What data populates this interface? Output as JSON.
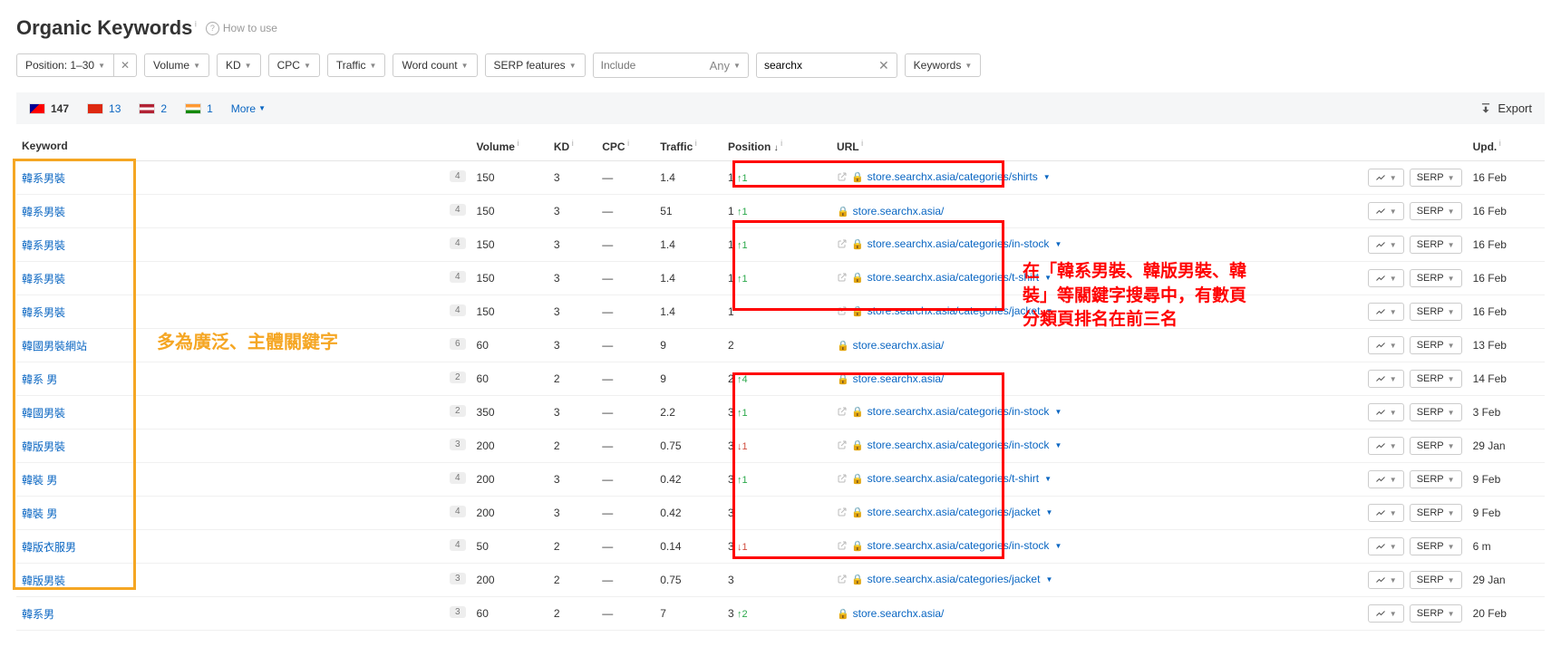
{
  "header": {
    "title": "Organic Keywords",
    "how_to_use": "How to use"
  },
  "filters": {
    "position": {
      "label": "Position: 1–30"
    },
    "volume": "Volume",
    "kd": "KD",
    "cpc": "CPC",
    "traffic": "Traffic",
    "wordcount": "Word count",
    "serp": "SERP features",
    "include": {
      "placeholder": "Include",
      "mode": "Any"
    },
    "search": {
      "value": "searchx"
    },
    "keywords": "Keywords"
  },
  "countries": [
    {
      "name": "TW",
      "count": "147",
      "flag_bg": "linear-gradient(135deg,#fe0000 50%,#000095 50%)"
    },
    {
      "name": "HK",
      "count": "13",
      "flag_bg": "#de2910"
    },
    {
      "name": "US",
      "count": "2",
      "flag_bg": "linear-gradient(#b22234 33%,#fff 33%,#fff 66%,#b22234 66%)"
    },
    {
      "name": "IN",
      "count": "1",
      "flag_bg": "linear-gradient(#ff9933 33%,#fff 33%,#fff 66%,#138808 66%)"
    }
  ],
  "more_label": "More",
  "export_label": "Export",
  "columns": {
    "keyword": "Keyword",
    "volume": "Volume",
    "kd": "KD",
    "cpc": "CPC",
    "traffic": "Traffic",
    "position": "Position",
    "url": "URL",
    "upd": "Upd."
  },
  "serp_btn": "SERP",
  "rows": [
    {
      "kw": "韓系男裝",
      "badge": "4",
      "vol": "150",
      "kd": "3",
      "cpc": "—",
      "traffic": "1.4",
      "pos": "1",
      "pos_ch": "1",
      "pos_dir": "up",
      "url": "store.searchx.asia/categories/shirts",
      "has_ext": true,
      "has_url_caret": true,
      "upd": "16 Feb"
    },
    {
      "kw": "韓系男裝",
      "badge": "4",
      "vol": "150",
      "kd": "3",
      "cpc": "—",
      "traffic": "51",
      "pos": "1",
      "pos_ch": "1",
      "pos_dir": "up",
      "url": "store.searchx.asia/",
      "has_ext": false,
      "has_url_caret": false,
      "upd": "16 Feb"
    },
    {
      "kw": "韓系男裝",
      "badge": "4",
      "vol": "150",
      "kd": "3",
      "cpc": "—",
      "traffic": "1.4",
      "pos": "1",
      "pos_ch": "1",
      "pos_dir": "up",
      "url": "store.searchx.asia/categories/in-stock",
      "has_ext": true,
      "has_url_caret": true,
      "upd": "16 Feb"
    },
    {
      "kw": "韓系男裝",
      "badge": "4",
      "vol": "150",
      "kd": "3",
      "cpc": "—",
      "traffic": "1.4",
      "pos": "1",
      "pos_ch": "1",
      "pos_dir": "up",
      "url": "store.searchx.asia/categories/t-shirt",
      "has_ext": true,
      "has_url_caret": true,
      "upd": "16 Feb"
    },
    {
      "kw": "韓系男裝",
      "badge": "4",
      "vol": "150",
      "kd": "3",
      "cpc": "—",
      "traffic": "1.4",
      "pos": "1",
      "pos_ch": "",
      "pos_dir": "",
      "url": "store.searchx.asia/categories/jacket",
      "has_ext": true,
      "has_url_caret": true,
      "upd": "16 Feb"
    },
    {
      "kw": "韓國男裝網站",
      "badge": "6",
      "vol": "60",
      "kd": "3",
      "cpc": "—",
      "traffic": "9",
      "pos": "2",
      "pos_ch": "",
      "pos_dir": "",
      "url": "store.searchx.asia/",
      "has_ext": false,
      "has_url_caret": false,
      "upd": "13 Feb"
    },
    {
      "kw": "韓系 男",
      "badge": "2",
      "vol": "60",
      "kd": "2",
      "cpc": "—",
      "traffic": "9",
      "pos": "2",
      "pos_ch": "4",
      "pos_dir": "up",
      "url": "store.searchx.asia/",
      "has_ext": false,
      "has_url_caret": false,
      "upd": "14 Feb"
    },
    {
      "kw": "韓國男裝",
      "badge": "2",
      "vol": "350",
      "kd": "3",
      "cpc": "—",
      "traffic": "2.2",
      "pos": "3",
      "pos_ch": "1",
      "pos_dir": "up",
      "url": "store.searchx.asia/categories/in-stock",
      "has_ext": true,
      "has_url_caret": true,
      "upd": "3 Feb"
    },
    {
      "kw": "韓版男裝",
      "badge": "3",
      "vol": "200",
      "kd": "2",
      "cpc": "—",
      "traffic": "0.75",
      "pos": "3",
      "pos_ch": "1",
      "pos_dir": "down",
      "url": "store.searchx.asia/categories/in-stock",
      "has_ext": true,
      "has_url_caret": true,
      "upd": "29 Jan"
    },
    {
      "kw": "韓裝 男",
      "badge": "4",
      "vol": "200",
      "kd": "3",
      "cpc": "—",
      "traffic": "0.42",
      "pos": "3",
      "pos_ch": "1",
      "pos_dir": "up",
      "url": "store.searchx.asia/categories/t-shirt",
      "has_ext": true,
      "has_url_caret": true,
      "upd": "9 Feb"
    },
    {
      "kw": "韓裝 男",
      "badge": "4",
      "vol": "200",
      "kd": "3",
      "cpc": "—",
      "traffic": "0.42",
      "pos": "3",
      "pos_ch": "",
      "pos_dir": "",
      "url": "store.searchx.asia/categories/jacket",
      "has_ext": true,
      "has_url_caret": true,
      "upd": "9 Feb"
    },
    {
      "kw": "韓版衣服男",
      "badge": "4",
      "vol": "50",
      "kd": "2",
      "cpc": "—",
      "traffic": "0.14",
      "pos": "3",
      "pos_ch": "1",
      "pos_dir": "down",
      "url": "store.searchx.asia/categories/in-stock",
      "has_ext": true,
      "has_url_caret": true,
      "upd": "6 m"
    },
    {
      "kw": "韓版男裝",
      "badge": "3",
      "vol": "200",
      "kd": "2",
      "cpc": "—",
      "traffic": "0.75",
      "pos": "3",
      "pos_ch": "",
      "pos_dir": "",
      "url": "store.searchx.asia/categories/jacket",
      "has_ext": true,
      "has_url_caret": true,
      "upd": "29 Jan"
    },
    {
      "kw": "韓系男",
      "badge": "3",
      "vol": "60",
      "kd": "2",
      "cpc": "—",
      "traffic": "7",
      "pos": "3",
      "pos_ch": "2",
      "pos_dir": "up",
      "url": "store.searchx.asia/",
      "has_ext": false,
      "has_url_caret": false,
      "upd": "20 Feb"
    }
  ],
  "annotations": {
    "orange_text": "多為廣泛、主體關鍵字",
    "red_text": "在「韓系男裝、韓版男裝、韓裝」等關鍵字搜尋中，有數頁分類頁排名在前三名"
  }
}
